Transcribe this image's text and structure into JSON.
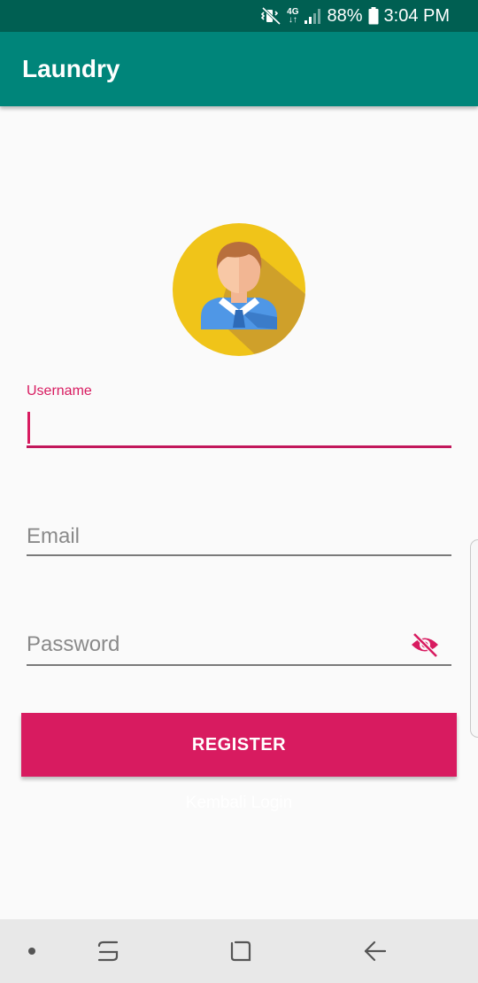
{
  "status_bar": {
    "network_top": "4G",
    "network_bottom": "↓↑",
    "battery": "88%",
    "time": "3:04 PM"
  },
  "app_bar": {
    "title": "Laundry"
  },
  "form": {
    "username": {
      "label": "Username",
      "value": ""
    },
    "email": {
      "placeholder": "Email",
      "value": ""
    },
    "password": {
      "placeholder": "Password",
      "value": "",
      "toggle_icon": "eye-off-icon"
    }
  },
  "register_label": "REGISTER",
  "back_login_label": "Kembali Login",
  "icons": {
    "avatar": "user-avatar-icon",
    "navigation": [
      "dot-icon",
      "recents-icon",
      "home-icon",
      "back-icon"
    ]
  },
  "colors": {
    "status_bar": "#005f52",
    "app_bar": "#00857a",
    "accent": "#d81b60",
    "avatar_bg": "#f0c419",
    "nav_bar": "#e8e8e8"
  }
}
